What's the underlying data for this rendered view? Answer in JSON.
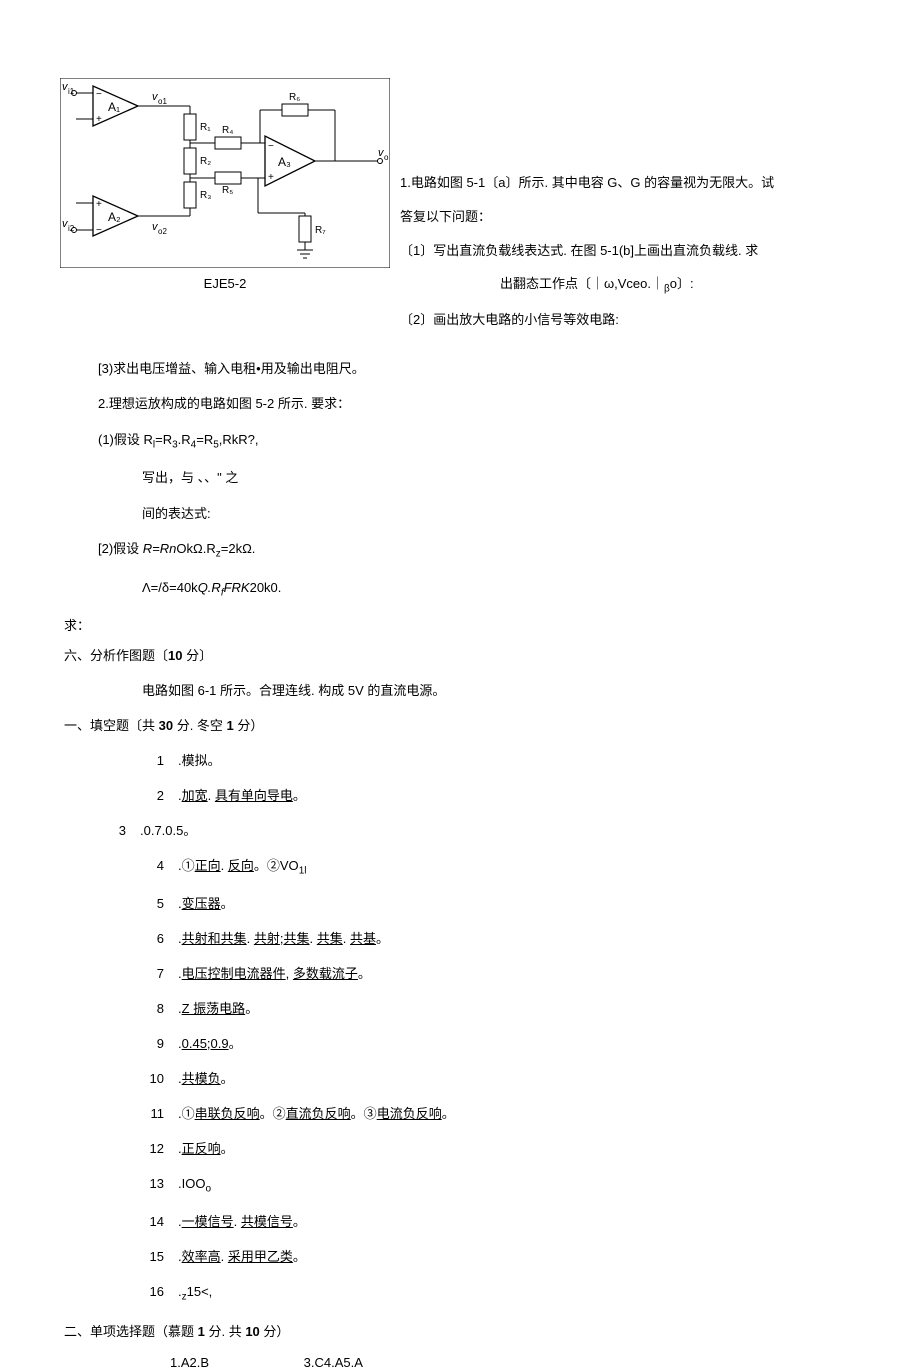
{
  "circuit": {
    "caption": "EJE5-2",
    "labels": {
      "vi1": "v_i1",
      "vi2": "v_i2",
      "vo1": "v_o1",
      "vo2": "v_o2",
      "vo": "v_o",
      "a1": "A₁",
      "a2": "A₂",
      "a3": "A₃",
      "r1": "R₁",
      "r2": "R₂",
      "r3": "R₃",
      "r4": "R₄",
      "r5": "R₅",
      "r6": "R₆",
      "r7": "R₇"
    }
  },
  "rightText": {
    "l1": "1.电路如图 5-1〔a〕所示. 其中电容 G、G 的容量视为无限大。试",
    "l2": "答复以下问题：",
    "l3": "〔1〕写出直流负载线表达式. 在图 5-1(b]上画出直流负载线. 求",
    "l4_pre": "出翻态工作点〔｜ω,Vceo.｜",
    "l4_sub": "β",
    "l4_post": "o〕:",
    "l5": "〔2〕画出放大电路的小信号等效电路:"
  },
  "body": {
    "b1": "[3)求出电压增益、输入电租•用及输出电阻尺。",
    "b2": "2.理想运放构成的电路如图 5-2 所示. 要求：",
    "b3_pre": "(1)假设 R",
    "b3_sub1": "l",
    "b3_mid1": "=R",
    "b3_sub2": "3",
    "b3_mid2": ".R",
    "b3_sub3": "4",
    "b3_mid3": "=R",
    "b3_sub4": "5",
    "b3_post": ",RkR?,",
    "b4": "写出，与 、、\" 之",
    "b5": "间的表达式:",
    "b6_pre": "[2)假设 ",
    "b6_r": "R=Rn",
    "b6_mid": "OkΩ.R",
    "b6_sub": "z",
    "b6_post": "=2kΩ.",
    "b7_pre": "Λ=/δ=40k",
    "b7_q": "Q.R",
    "b7_sub": "f",
    "b7_frk": "FRK",
    "b7_post": "20k0.",
    "b8": "求：",
    "sec6_head": "六、分析作图题〔",
    "sec6_bold": "10",
    "sec6_tail": " 分〕",
    "b9": "电路如图 6-1 所示。合理连线. 构成 5V 的直流电源。",
    "sec1_head": "一、填空题〔共 ",
    "sec1_b1": "30",
    "sec1_mid": " 分. 冬空 ",
    "sec1_b2": "1",
    "sec1_tail": " 分）"
  },
  "fillItems": [
    {
      "n": "1",
      "parts": [
        {
          "t": ".模拟。"
        }
      ]
    },
    {
      "n": "2",
      "parts": [
        {
          "t": "."
        },
        {
          "t": "加宽",
          "u": true
        },
        {
          "t": ". "
        },
        {
          "t": "具有单向导电",
          "u": true
        },
        {
          "t": "。"
        }
      ]
    },
    {
      "n": "3",
      "special": true,
      "parts": [
        {
          "t": ".0.7.0.5。"
        }
      ]
    },
    {
      "n": "4",
      "parts": [
        {
          "t": ".①"
        },
        {
          "t": "正向",
          "u": true
        },
        {
          "t": ". "
        },
        {
          "t": "反向",
          "u": true
        },
        {
          "t": "。②VO"
        },
        {
          "t": "1l",
          "sub": true
        }
      ]
    },
    {
      "n": "5",
      "parts": [
        {
          "t": "."
        },
        {
          "t": "变压器",
          "u": true
        },
        {
          "t": "。"
        }
      ]
    },
    {
      "n": "6",
      "parts": [
        {
          "t": "."
        },
        {
          "t": "共射和共集",
          "u": true
        },
        {
          "t": ". "
        },
        {
          "t": "共射",
          "u": true
        },
        {
          "t": ";"
        },
        {
          "t": "共集",
          "u": true
        },
        {
          "t": ". "
        },
        {
          "t": "共集",
          "u": true
        },
        {
          "t": ". "
        },
        {
          "t": "共基",
          "u": true
        },
        {
          "t": "。"
        }
      ]
    },
    {
      "n": "7",
      "parts": [
        {
          "t": "."
        },
        {
          "t": "电压控制电流器件",
          "u": true
        },
        {
          "t": ", "
        },
        {
          "t": "多数载流子",
          "u": true
        },
        {
          "t": "。"
        }
      ]
    },
    {
      "n": "8",
      "parts": [
        {
          "t": "."
        },
        {
          "t": "Z 振荡电路",
          "u": true
        },
        {
          "t": "。"
        }
      ]
    },
    {
      "n": "9",
      "parts": [
        {
          "t": "."
        },
        {
          "t": "0.45;0.9",
          "u": true
        },
        {
          "t": "。"
        }
      ]
    },
    {
      "n": "10",
      "parts": [
        {
          "t": "."
        },
        {
          "t": "共模负",
          "u": true
        },
        {
          "t": "。"
        }
      ]
    },
    {
      "n": "11",
      "parts": [
        {
          "t": ".①"
        },
        {
          "t": "串联负反响",
          "u": true
        },
        {
          "t": "。②"
        },
        {
          "t": "直流负反响",
          "u": true
        },
        {
          "t": "。③"
        },
        {
          "t": "电流负反响",
          "u": true
        },
        {
          "t": "。"
        }
      ]
    },
    {
      "n": "12",
      "parts": [
        {
          "t": "."
        },
        {
          "t": "正反响",
          "u": true
        },
        {
          "t": "。"
        }
      ]
    },
    {
      "n": "13",
      "parts": [
        {
          "t": ".IOO"
        },
        {
          "t": "o",
          "sub": true
        }
      ]
    },
    {
      "n": "14",
      "parts": [
        {
          "t": "."
        },
        {
          "t": "一模信号",
          "u": true
        },
        {
          "t": ". "
        },
        {
          "t": "共模信号",
          "u": true
        },
        {
          "t": "。"
        }
      ]
    },
    {
      "n": "15",
      "parts": [
        {
          "t": "."
        },
        {
          "t": "效率高",
          "u": true
        },
        {
          "t": ". "
        },
        {
          "t": "采用甲乙类",
          "u": true
        },
        {
          "t": "。"
        }
      ]
    },
    {
      "n": "16",
      "parts": [
        {
          "t": "."
        },
        {
          "t": "z",
          "sub": true
        },
        {
          "t": "15<,"
        }
      ]
    }
  ],
  "sec2": {
    "head": "二、单项选择题（慕题 ",
    "b1": "1",
    "mid": " 分. 共 ",
    "b2": "10",
    "tail": " 分）",
    "answers1": "1.A2.B",
    "answers2": "3.C4.A5.A"
  }
}
